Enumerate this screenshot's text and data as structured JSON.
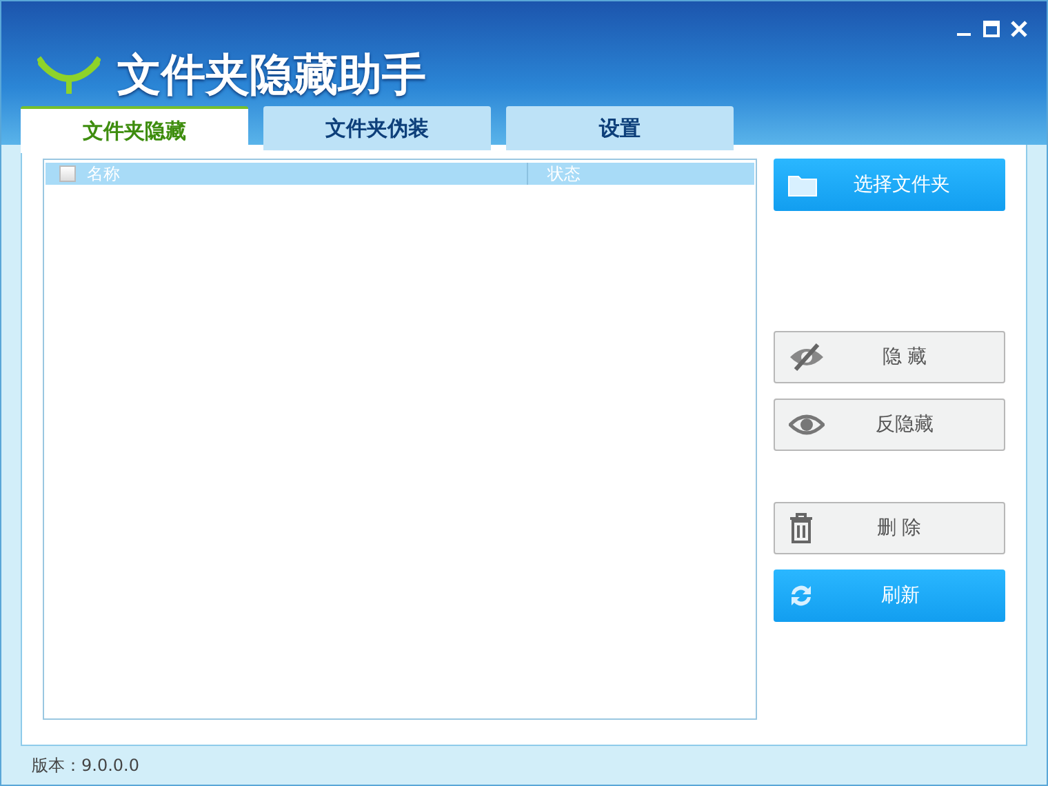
{
  "window": {
    "title": "文件夹隐藏助手"
  },
  "tabs": [
    {
      "label": "文件夹隐藏",
      "selected": true
    },
    {
      "label": "文件夹伪装",
      "selected": false
    },
    {
      "label": "设置",
      "selected": false
    }
  ],
  "table": {
    "select_all_checked": false,
    "columns": [
      "名称",
      "状态"
    ]
  },
  "actions": [
    {
      "label": "选择文件夹",
      "kind": "primary"
    },
    {
      "label": "隐 藏",
      "kind": "secondary"
    },
    {
      "label": "反隐藏",
      "kind": "secondary"
    },
    {
      "label": "删 除",
      "kind": "secondary"
    },
    {
      "label": "刷新",
      "kind": "primary"
    }
  ],
  "status_bar": {
    "version": "版本：9.0.0.0"
  }
}
